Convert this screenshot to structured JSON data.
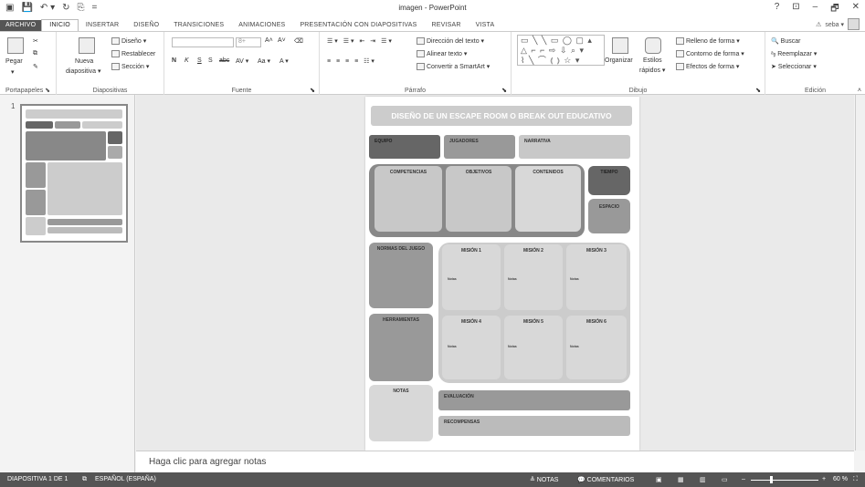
{
  "window": {
    "title": "imagen - PowerPoint",
    "help": "?",
    "restore_ribbon": "⊡",
    "minimize": "–",
    "maximize": "🗗",
    "close": "✕"
  },
  "qat": [
    "💾",
    "↶ ▾",
    "↻",
    "⎘",
    "="
  ],
  "tabs": [
    "ARCHIVO",
    "INICIO",
    "INSERTAR",
    "DISEÑO",
    "TRANSICIONES",
    "ANIMACIONES",
    "PRESENTACIÓN CON DIAPOSITIVAS",
    "REVISAR",
    "VISTA"
  ],
  "user": {
    "warning": "⚠",
    "name": "seba ▾"
  },
  "ribbon": {
    "portapapeles": {
      "label": "Portapapeles ⬊",
      "paste": "Pegar",
      "paste_arrow": "▾"
    },
    "diapositivas": {
      "label": "Diapositivas",
      "new_slide": "Nueva",
      "new_slide2": "diapositiva ▾",
      "layout": "Diseño ▾",
      "reset": "Restablecer",
      "section": "Sección ▾"
    },
    "fuente": {
      "label": "Fuente",
      "font_size": "8+",
      "grow": "A˄",
      "shrink": "A˅",
      "clear": "⌫",
      "bold": "N",
      "italic": "K",
      "underline": "S",
      "shadow": "S",
      "strike": "abc",
      "spacing": "AV ▾",
      "case": "Aa ▾",
      "color": "A ▾",
      "launcher": "⬊"
    },
    "parrafo": {
      "label": "Párrafo",
      "text_direction": "Dirección del texto ▾",
      "align_text": "Alinear texto ▾",
      "smartart": "Convertir a SmartArt ▾",
      "launcher": "⬊"
    },
    "dibujo": {
      "label": "Dibujo",
      "shapes_row1": "▭ ╲ ╲ ▭ ◯ ▢ ▴",
      "shapes_row2": "△ ⌐ ⌐ ⇨ ⇩ ⌕ ▾",
      "shapes_row3": "⌇ ╲ ⌒ ⦅ ⦆ ☆ ▾",
      "organize": "Organizar",
      "quick_styles": "Estilos",
      "quick_styles2": "rápidos ▾",
      "fill": "Relleno de forma ▾",
      "outline": "Contorno de forma ▾",
      "effects": "Efectos de forma ▾",
      "launcher": "⬊"
    },
    "edicion": {
      "label": "Edición",
      "find": "Buscar",
      "replace": "Reemplazar ▾",
      "select": "Seleccionar ▾",
      "collapse": "˄"
    }
  },
  "thumbnails": {
    "number": "1"
  },
  "slide": {
    "title": "DISEÑO DE UN ESCAPE ROOM O BREAK OUT EDUCATIVO",
    "equipo": "EQUIPO",
    "jugadores": "JUGADORES",
    "narrativa": "NARRATIVA",
    "competencias": "COMPETENCIAS",
    "objetivos": "OBJETIVOS",
    "contenidos": "CONTENIDOS",
    "tiempo": "TIEMPO",
    "espacio": "ESPACIO",
    "normas": "NORMAS DEL JUEGO",
    "herramientas": "HERRAMIENTAS",
    "notas": "NOTAS",
    "evaluacion": "EVALUACIÓN",
    "recompensas": "RECOMPENSAS",
    "missions": [
      {
        "title": "MISIÓN 1",
        "note": "Notas"
      },
      {
        "title": "MISIÓN 2",
        "note": "Notas"
      },
      {
        "title": "MISIÓN 3",
        "note": "Notas"
      },
      {
        "title": "MISIÓN 4",
        "note": "Notas"
      },
      {
        "title": "MISIÓN 5",
        "note": "Notas"
      },
      {
        "title": "MISIÓN 6",
        "note": "Notas"
      }
    ]
  },
  "notes_placeholder": "Haga clic para agregar notas",
  "status": {
    "slide_count": "DIAPOSITIVA 1 DE 1",
    "spell_icon": "⧉",
    "language": "ESPAÑOL (ESPAÑA)",
    "notes": "≜ NOTAS",
    "comments": "💬 COMENTARIOS",
    "view_normal": "▣",
    "view_sorter": "▦",
    "view_reading": "▥",
    "view_show": "▭",
    "zoom_minus": "–",
    "zoom_plus": "+",
    "zoom": "60 %",
    "fit": "⛶"
  },
  "colors": {
    "status_bar": "#555555",
    "file_tab": "#555555",
    "slide_title_bg": "#cccccc"
  }
}
